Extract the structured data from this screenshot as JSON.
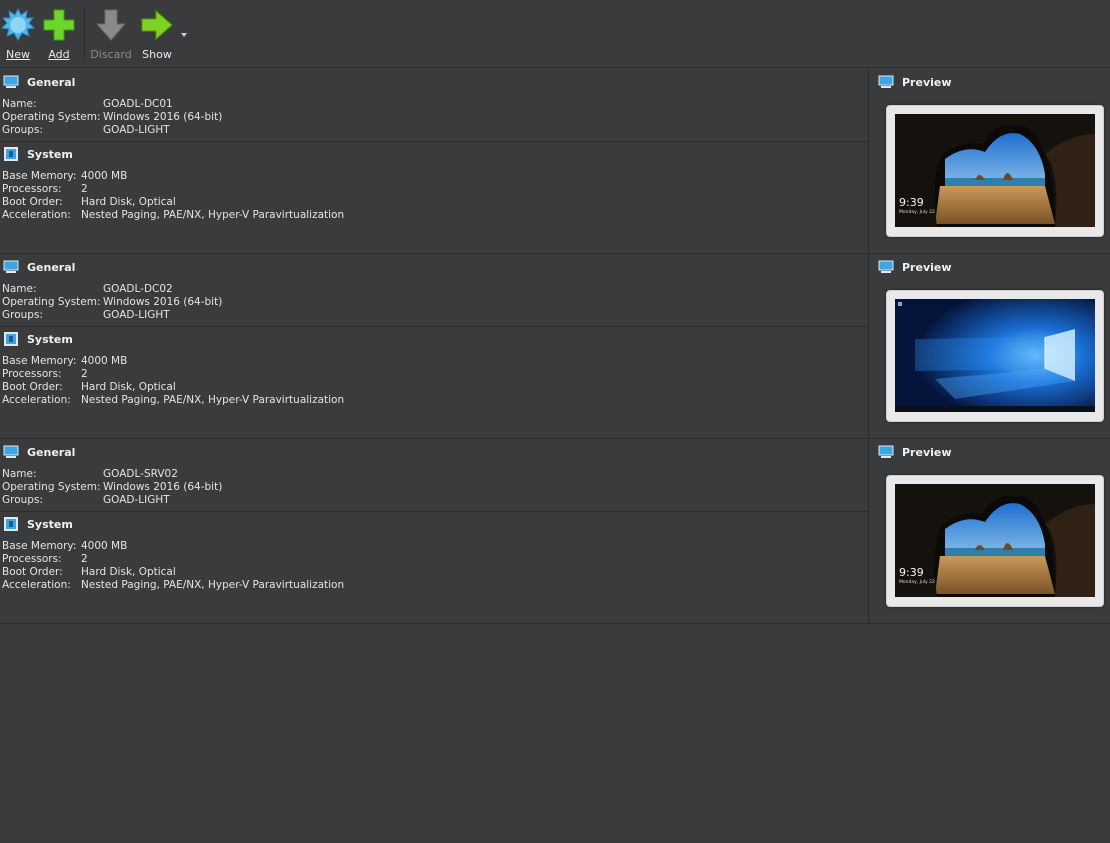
{
  "toolbar": {
    "new_label": "New",
    "add_label": "Add",
    "discard_label": "Discard",
    "show_label": "Show"
  },
  "labels": {
    "general": "General",
    "system": "System",
    "preview": "Preview",
    "name": "Name:",
    "os": "Operating System:",
    "groups": "Groups:",
    "base_memory": "Base Memory:",
    "processors": "Processors:",
    "boot_order": "Boot Order:",
    "acceleration": "Acceleration:"
  },
  "vms": [
    {
      "name": "GOADL-DC01",
      "os": "Windows 2016 (64-bit)",
      "groups": "GOAD-LIGHT",
      "base_memory": "4000 MB",
      "processors": "2",
      "boot_order": "Hard Disk, Optical",
      "acceleration": "Nested Paging, PAE/NX, Hyper-V Paravirtualization",
      "preview_type": "lockscreen",
      "clock": "9:39",
      "date": "Monday, July 22"
    },
    {
      "name": "GOADL-DC02",
      "os": "Windows 2016 (64-bit)",
      "groups": "GOAD-LIGHT",
      "base_memory": "4000 MB",
      "processors": "2",
      "boot_order": "Hard Disk, Optical",
      "acceleration": "Nested Paging, PAE/NX, Hyper-V Paravirtualization",
      "preview_type": "desktop"
    },
    {
      "name": "GOADL-SRV02",
      "os": "Windows 2016 (64-bit)",
      "groups": "GOAD-LIGHT",
      "base_memory": "4000 MB",
      "processors": "2",
      "boot_order": "Hard Disk, Optical",
      "acceleration": "Nested Paging, PAE/NX, Hyper-V Paravirtualization",
      "preview_type": "lockscreen",
      "clock": "9:39",
      "date": "Monday, July 22"
    }
  ],
  "colors": {
    "background": "#3a3b3d",
    "new_icon": "#4fb8e8",
    "add_icon": "#6dd62a",
    "show_icon": "#7ed321",
    "discard_icon": "#8a8a8a",
    "section_icon": "#3aa6e6"
  },
  "icons": {
    "new": "starburst-icon",
    "add": "plus-icon",
    "discard": "down-arrow-icon",
    "show": "right-arrow-icon",
    "general": "monitor-icon",
    "system": "chip-icon",
    "preview": "monitor-icon"
  }
}
